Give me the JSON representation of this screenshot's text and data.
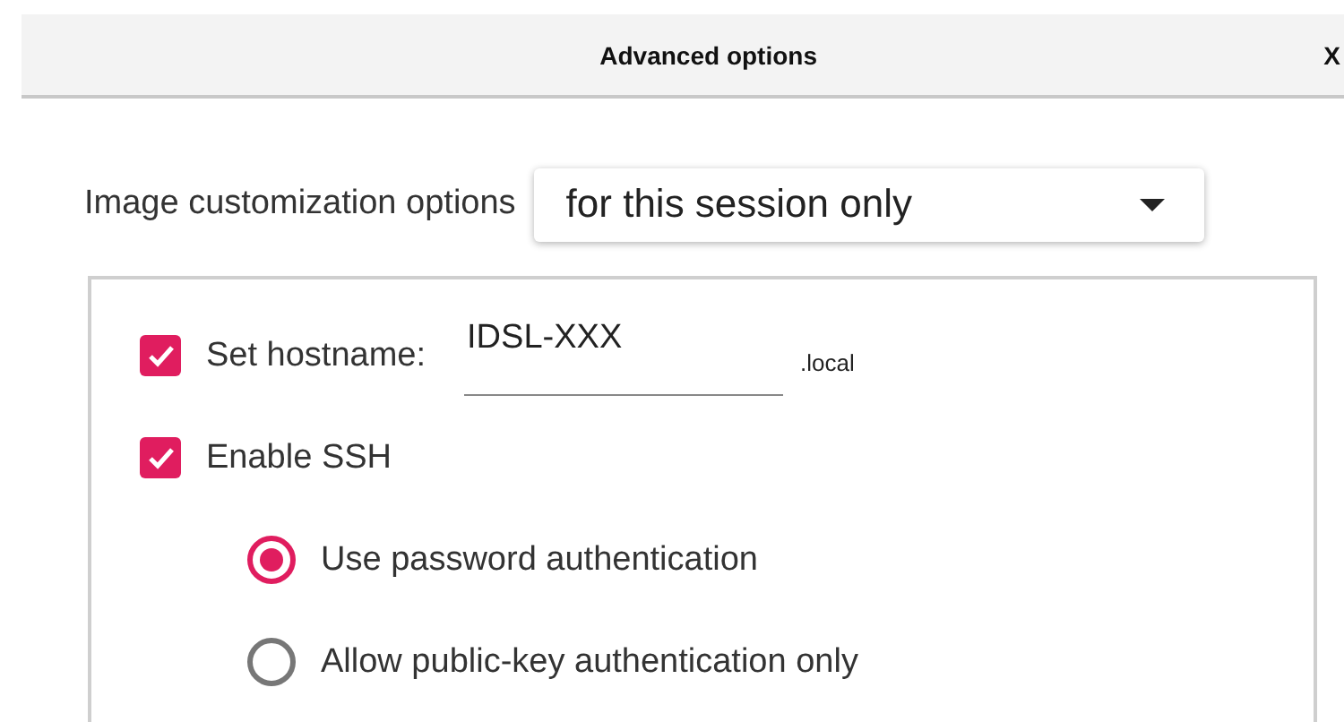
{
  "window": {
    "title": "Advanced options",
    "close": "X"
  },
  "customization": {
    "label": "Image customization options",
    "value": "for this session only"
  },
  "options": [
    {
      "kind": "checkbox",
      "label": "Set hostname:",
      "checked": true,
      "field": {
        "value": "IDSL-XXX"
      },
      "suffix": ".local"
    },
    {
      "kind": "checkbox",
      "label": "Enable SSH",
      "checked": true
    },
    {
      "kind": "radio",
      "label": "Use password authentication",
      "selected": true
    },
    {
      "kind": "radio",
      "label": "Allow public-key authentication only",
      "selected": false
    }
  ]
}
